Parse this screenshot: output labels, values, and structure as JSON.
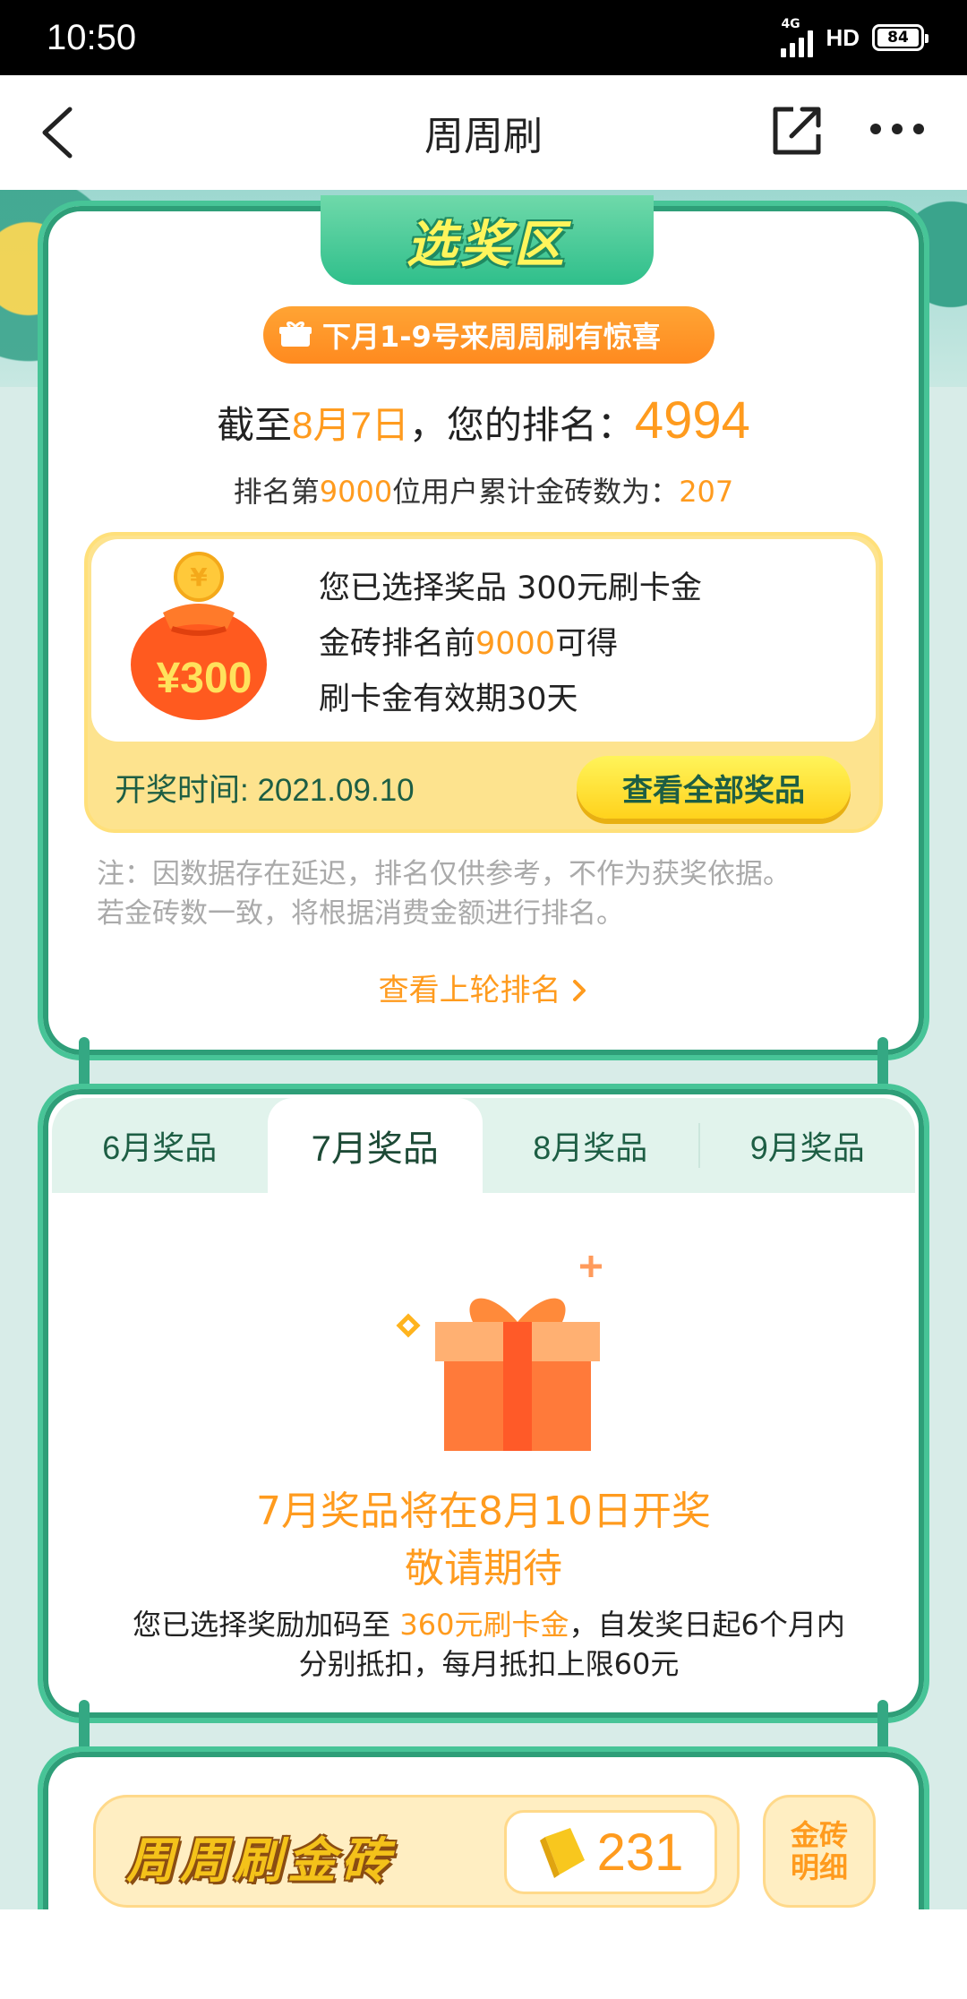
{
  "status_bar": {
    "time": "10:50",
    "network": "4G",
    "hd": "HD",
    "battery": "84"
  },
  "nav": {
    "title": "周周刷"
  },
  "award_section": {
    "header": "选奖区",
    "banner": "下月1-9号来周周刷有惊喜",
    "rank_prefix": "截至",
    "rank_date": "8月7日",
    "rank_mid": "，您的排名：",
    "rank_value": "4994",
    "threshold_prefix": "排名第",
    "threshold_rank": "9000",
    "threshold_mid": "位用户累计金砖数为：",
    "threshold_value": "207",
    "prize": {
      "badge": "¥300",
      "selected": "您已选择奖品 300元刷卡金",
      "condition_prefix": "金砖排名前",
      "condition_rank": "9000",
      "condition_suffix": "可得",
      "validity": "刷卡金有效期30天",
      "draw_time": "开奖时间: 2021.09.10",
      "view_all": "查看全部奖品"
    },
    "note_line1": "注：因数据存在延迟，排名仅供参考，不作为获奖依据。",
    "note_line2": "若金砖数一致，将根据消费金额进行排名。",
    "last_round": "查看上轮排名"
  },
  "monthly_prizes": {
    "tabs": [
      "6月奖品",
      "7月奖品",
      "8月奖品",
      "9月奖品"
    ],
    "active_tab": "7月奖品",
    "announce_line1": "7月奖品将在8月10日开奖",
    "announce_line2": "敬请期待",
    "boost_prefix": "您已选择奖励加码至 ",
    "boost_amount": "360元刷卡金",
    "boost_suffix": "，自发奖日起6个月内",
    "boost_line2": "分别抵扣，每月抵扣上限60元"
  },
  "gold_brick": {
    "title": "周周刷金砖",
    "count": "231",
    "detail_line1": "金砖",
    "detail_line2": "明细"
  },
  "colors": {
    "accent_orange": "#ff9b1e",
    "panel_green": "#47c497",
    "dark_green": "#1d5e44"
  }
}
